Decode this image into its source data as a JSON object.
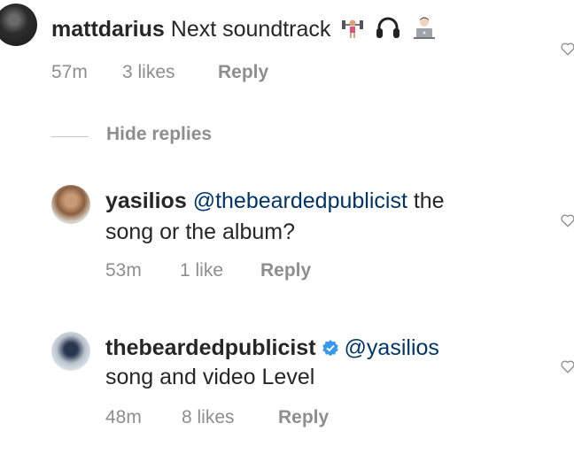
{
  "comments": [
    {
      "username": "mattdarius",
      "text": "Next soundtrack",
      "emojis": [
        "weightlifter-emoji",
        "headphones-emoji",
        "technologist-emoji"
      ],
      "time": "57m",
      "likes": "3 likes",
      "reply": "Reply"
    }
  ],
  "replies_toggle": "Hide replies",
  "replies": [
    {
      "username": "yasilios",
      "mention": "@thebeardedpublicist",
      "text_line1_rest": " the",
      "text_line2": "song or the album?",
      "time": "53m",
      "likes": "1 like",
      "reply": "Reply"
    },
    {
      "username": "thebeardedpublicist",
      "verified": true,
      "mention": "@yasilios",
      "text_line2": "song and video Level",
      "time": "48m",
      "likes": "8 likes",
      "reply": "Reply"
    }
  ],
  "colors": {
    "text": "#262626",
    "meta": "#8e8e8e",
    "mention": "#003569",
    "verified": "#3897f0"
  }
}
